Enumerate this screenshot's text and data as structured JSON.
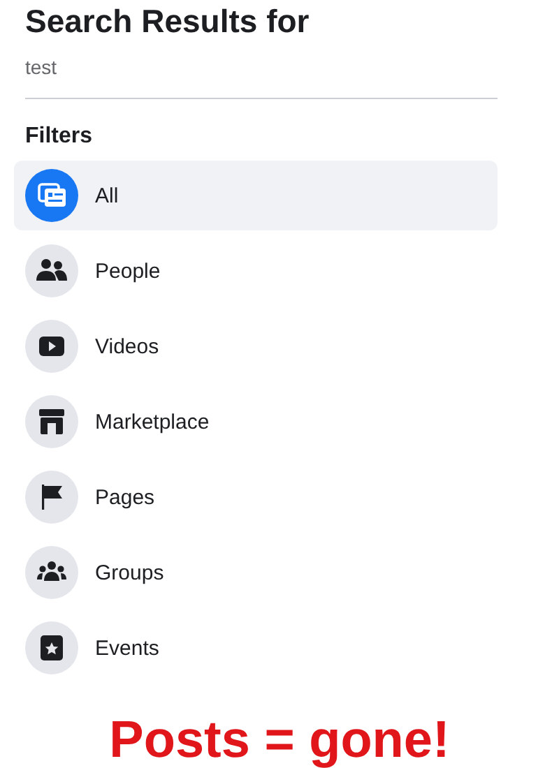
{
  "header": {
    "title": "Search Results for",
    "query": "test"
  },
  "filters": {
    "heading": "Filters",
    "items": [
      {
        "label": "All",
        "kind": "all",
        "selected": true
      },
      {
        "label": "People",
        "kind": "people",
        "selected": false
      },
      {
        "label": "Videos",
        "kind": "videos",
        "selected": false
      },
      {
        "label": "Marketplace",
        "kind": "marketplace",
        "selected": false
      },
      {
        "label": "Pages",
        "kind": "pages",
        "selected": false
      },
      {
        "label": "Groups",
        "kind": "groups",
        "selected": false
      },
      {
        "label": "Events",
        "kind": "events",
        "selected": false
      }
    ]
  },
  "caption": "Posts = gone!"
}
